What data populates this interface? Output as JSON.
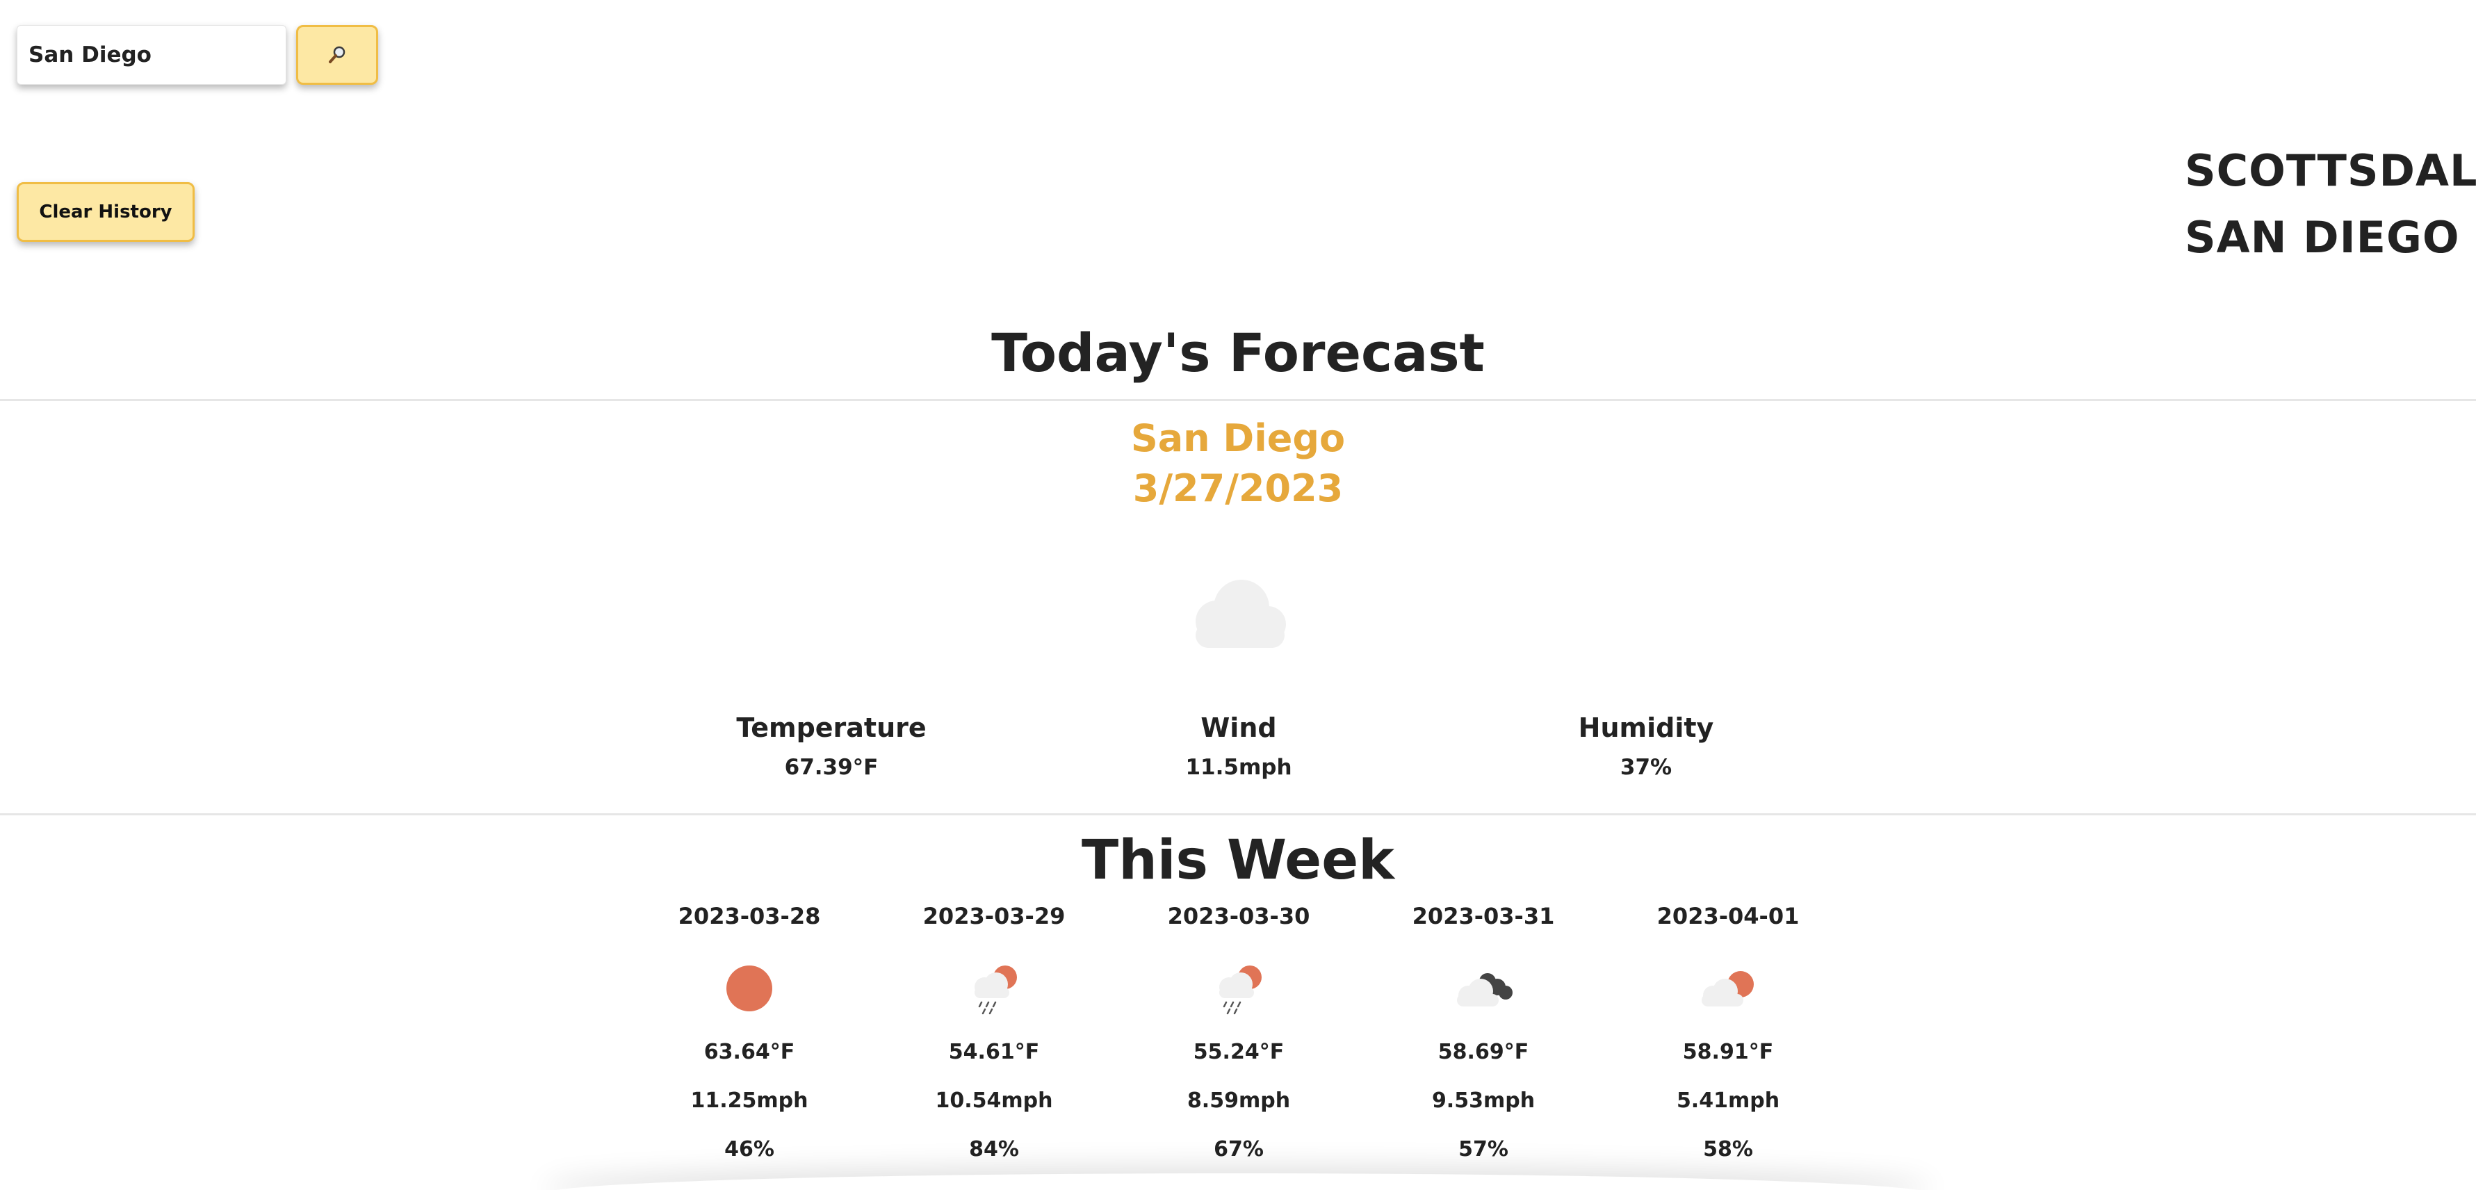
{
  "search": {
    "value": "San Diego",
    "button_icon": "magnifier-icon"
  },
  "clear_history_label": "Clear History",
  "history": [
    "SCOTTSDALE",
    "SAN DIEGO"
  ],
  "today": {
    "section_title": "Today's Forecast",
    "city": "San Diego",
    "date": "3/27/2023",
    "icon": "cloud-icon",
    "temperature_label": "Temperature",
    "temperature_value": "67.39°F",
    "wind_label": "Wind",
    "wind_value": "11.5mph",
    "humidity_label": "Humidity",
    "humidity_value": "37%"
  },
  "week": {
    "section_title": "This Week",
    "days": [
      {
        "date": "2023-03-28",
        "icon": "sun-icon",
        "temp": "63.64°F",
        "wind": "11.25mph",
        "humidity": "46%"
      },
      {
        "date": "2023-03-29",
        "icon": "rain-sun-icon",
        "temp": "54.61°F",
        "wind": "10.54mph",
        "humidity": "84%"
      },
      {
        "date": "2023-03-30",
        "icon": "rain-sun-icon",
        "temp": "55.24°F",
        "wind": "8.59mph",
        "humidity": "67%"
      },
      {
        "date": "2023-03-31",
        "icon": "broken-clouds-icon",
        "temp": "58.69°F",
        "wind": "9.53mph",
        "humidity": "57%"
      },
      {
        "date": "2023-04-01",
        "icon": "partly-cloudy-icon",
        "temp": "58.91°F",
        "wind": "5.41mph",
        "humidity": "58%"
      }
    ]
  },
  "colors": {
    "accent": "#e6a83b",
    "button_fill": "#fde8a4",
    "button_border": "#f0bd45",
    "sun": "#e07456",
    "cloud_light": "#f0f0f0",
    "cloud_dark": "#444444"
  }
}
